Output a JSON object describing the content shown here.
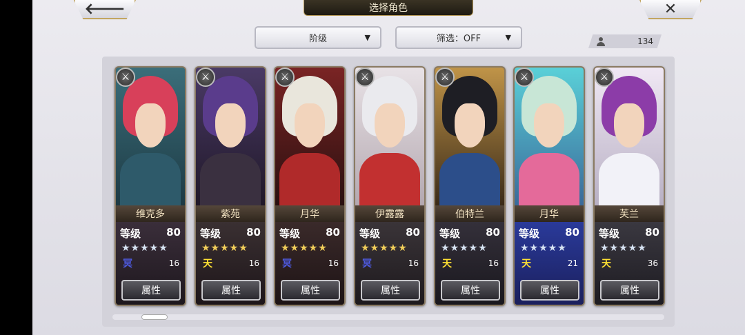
{
  "header": {
    "back_icon": "arrow-left-icon",
    "back_glyph": "🡐",
    "title": "选择角色",
    "close_icon": "close-icon",
    "close_glyph": "✕"
  },
  "filters": {
    "sort_label": "阶级",
    "filter_label": "筛选：OFF",
    "caret": "▼"
  },
  "roster_count": "134",
  "level_label": "等级",
  "attr_label": "属性",
  "colors": {
    "blue_rank": "#4e5ae0",
    "yellow_rank": "#ffe133",
    "gold_star": "#f2cf5a",
    "silver_star": "#d8e4f4"
  },
  "cards": [
    {
      "name": "维克多",
      "level": "80",
      "stars": "★★★★★",
      "star_color": "silver",
      "rank_glyph": "冥",
      "rank_color": "blue",
      "count": "16",
      "class_icon": "sword-class-icon"
    },
    {
      "name": "紫苑",
      "level": "80",
      "stars": "★★★★★",
      "star_color": "gold",
      "rank_glyph": "天",
      "rank_color": "yellow",
      "count": "16",
      "class_icon": "sword-class-icon"
    },
    {
      "name": "月华",
      "level": "80",
      "stars": "★★★★★",
      "star_color": "gold",
      "rank_glyph": "冥",
      "rank_color": "blue",
      "count": "16",
      "class_icon": "bow-class-icon"
    },
    {
      "name": "伊露露",
      "level": "80",
      "stars": "★★★★★",
      "star_color": "gold",
      "rank_glyph": "冥",
      "rank_color": "blue",
      "count": "16",
      "class_icon": "axe-class-icon"
    },
    {
      "name": "伯特兰",
      "level": "80",
      "stars": "★★★★★",
      "star_color": "silver",
      "rank_glyph": "天",
      "rank_color": "yellow",
      "count": "16",
      "class_icon": "lance-class-icon"
    },
    {
      "name": "月华",
      "level": "80",
      "stars": "★★★★★",
      "star_color": "silver",
      "rank_glyph": "天",
      "rank_color": "yellow",
      "count": "21",
      "class_icon": "bow-class-icon"
    },
    {
      "name": "芙兰",
      "level": "80",
      "stars": "★★★★★",
      "star_color": "silver",
      "rank_glyph": "天",
      "rank_color": "yellow",
      "count": "36",
      "class_icon": "lance-class-icon"
    }
  ]
}
